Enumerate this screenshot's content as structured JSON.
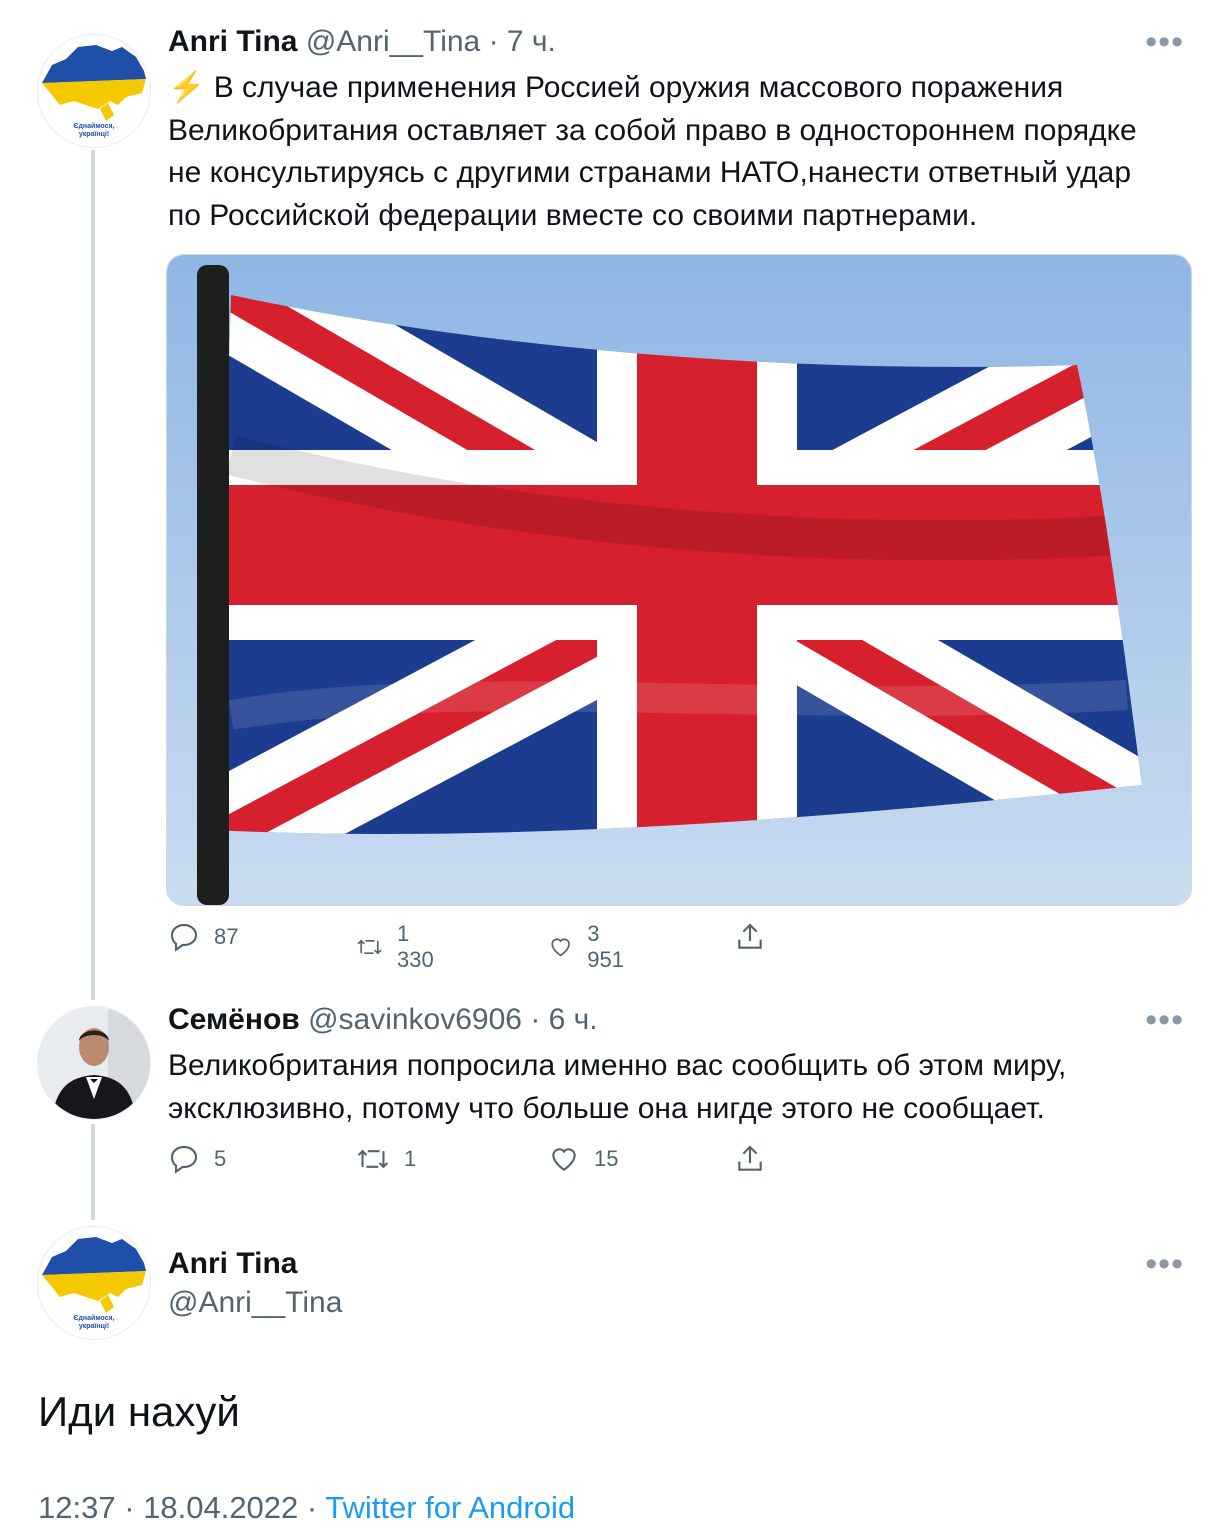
{
  "tweets": [
    {
      "name": "Anri Tina",
      "handle": "@Anri__Tina",
      "time": "· 7 ч.",
      "avatar_caption": [
        "Єднаймося,",
        "українці!"
      ],
      "lines": [
        "⚡ В случае применения Россией оружия массового поражения",
        "Великобритания оставляет за собой право в одностороннем порядке",
        "не консультируясь с другими странами НАТО,нанести ответный удар",
        "по Российской федерации вместе со своими партнерами."
      ],
      "media_description": "Union Jack flag on pole",
      "stats": {
        "replies": "87",
        "retweets": "1 330",
        "likes": "3 951"
      }
    },
    {
      "name": "Семёнов",
      "handle": "@savinkov6906",
      "time": "· 6 ч.",
      "lines": [
        "Великобритания попросила именно вас сообщить об этом миру,",
        "эксклюзивно,  потому что больше она нигде этого не сообщает."
      ],
      "stats": {
        "replies": "5",
        "retweets": "1",
        "likes": "15"
      }
    }
  ],
  "main_tweet": {
    "name": "Anri Tina",
    "handle": "@Anri__Tina",
    "avatar_caption": [
      "Єднаймося,",
      "українці!"
    ],
    "text": "Иди нахуй",
    "time": "12:37 · 18.04.2022 · ",
    "source": "Twitter for Android"
  },
  "icons": {
    "reply": "reply-icon",
    "retweet": "retweet-icon",
    "like": "heart-icon",
    "share": "share-icon",
    "more": "more-icon"
  },
  "colors": {
    "accent": "#1d9bf0",
    "secondary_text": "#536471",
    "thread_line": "#cfd9de"
  }
}
